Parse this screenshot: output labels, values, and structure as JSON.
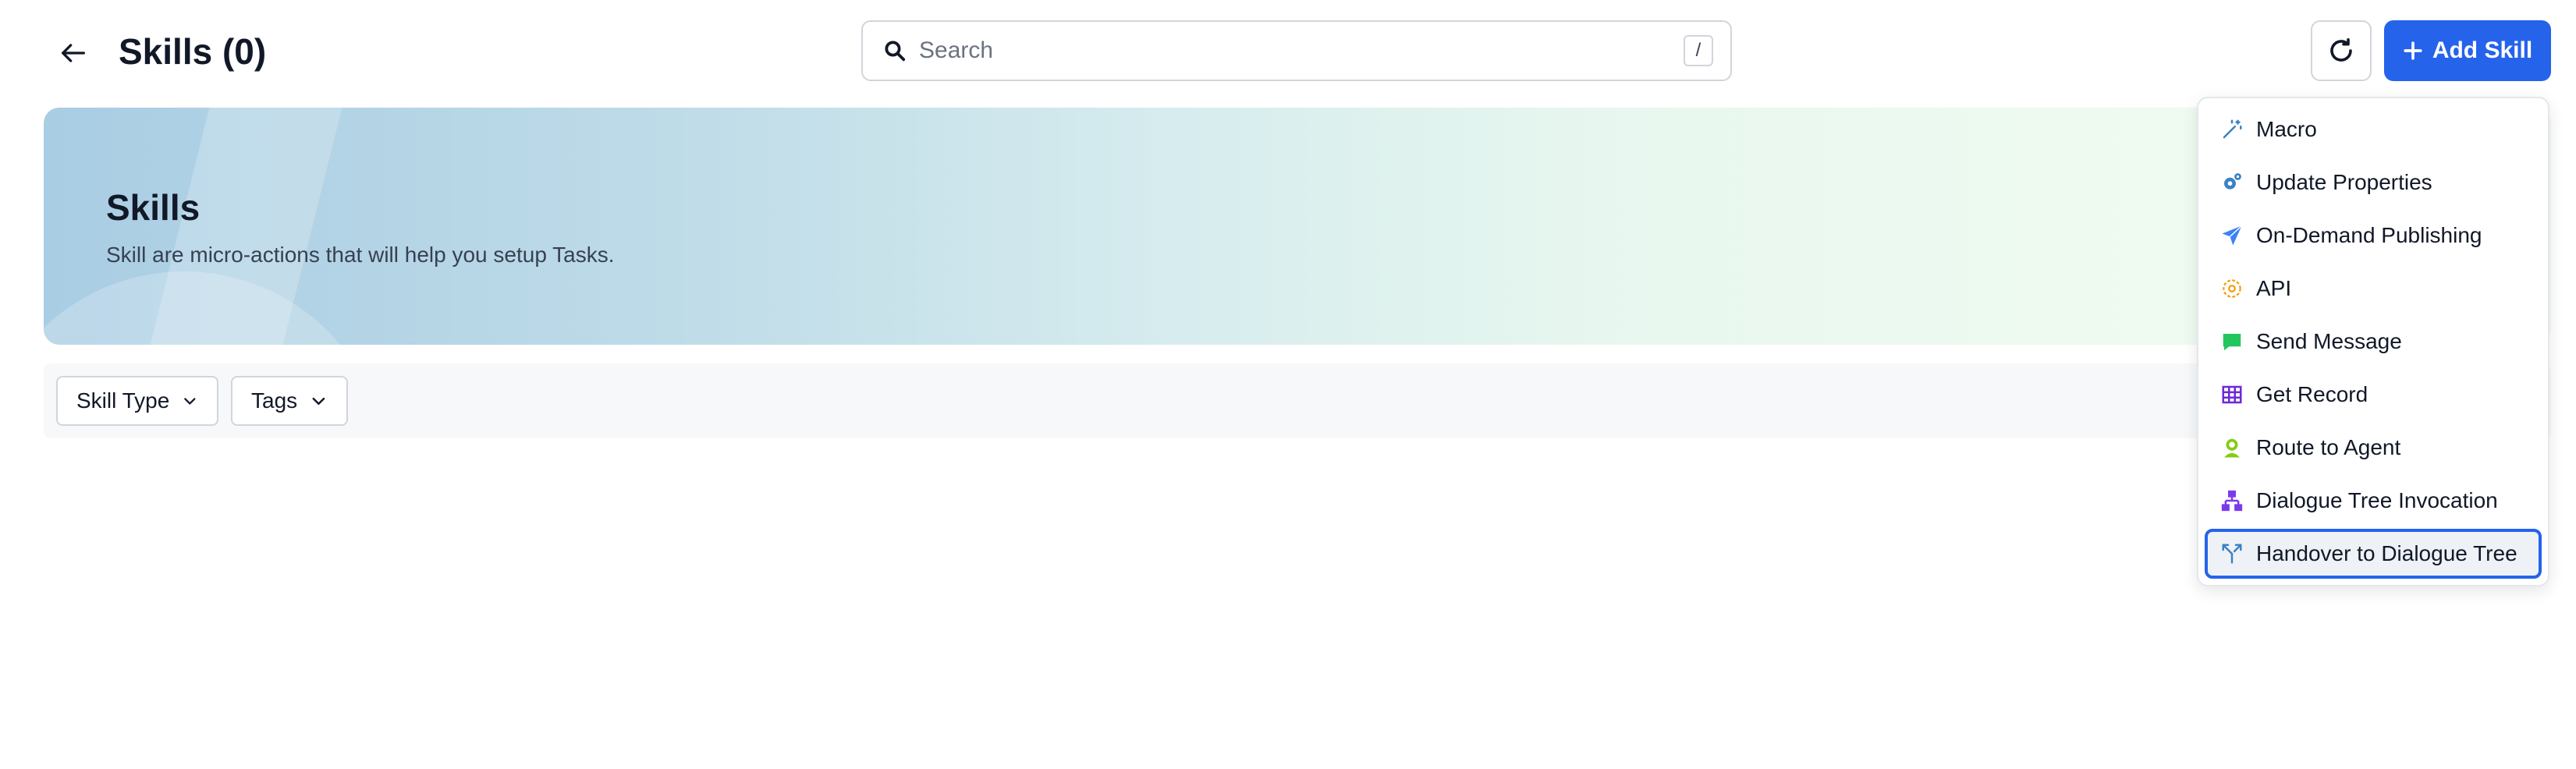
{
  "header": {
    "title": "Skills (0)",
    "search_placeholder": "Search",
    "search_shortcut": "/",
    "add_skill_label": "Add Skill"
  },
  "banner": {
    "title": "Skills",
    "subtitle": "Skill are micro-actions that will help you setup Tasks."
  },
  "filters": {
    "skill_type_label": "Skill Type",
    "tags_label": "Tags"
  },
  "menu": {
    "items": [
      {
        "label": "Macro",
        "icon": "magic-wand-icon"
      },
      {
        "label": "Update Properties",
        "icon": "gears-icon"
      },
      {
        "label": "On-Demand Publishing",
        "icon": "paper-plane-icon"
      },
      {
        "label": "API",
        "icon": "api-gear-icon"
      },
      {
        "label": "Send Message",
        "icon": "message-bubble-icon"
      },
      {
        "label": "Get Record",
        "icon": "table-grid-icon"
      },
      {
        "label": "Route to Agent",
        "icon": "agent-icon"
      },
      {
        "label": "Dialogue Tree Invocation",
        "icon": "hierarchy-icon"
      },
      {
        "label": "Handover to Dialogue Tree",
        "icon": "branch-split-icon"
      }
    ],
    "focused_index": 8
  },
  "colors": {
    "primary": "#2563eb",
    "macro_icon": "#3b82c4",
    "update_properties_icon": "#3b82c4",
    "publishing_icon": "#3b82f6",
    "api_icon": "#f59e0b",
    "send_message_icon": "#22c55e",
    "get_record_icon": "#6d28d9",
    "route_agent_icon": "#84cc16",
    "dialogue_tree_icon": "#7c3aed",
    "handover_icon": "#3b82c4"
  }
}
